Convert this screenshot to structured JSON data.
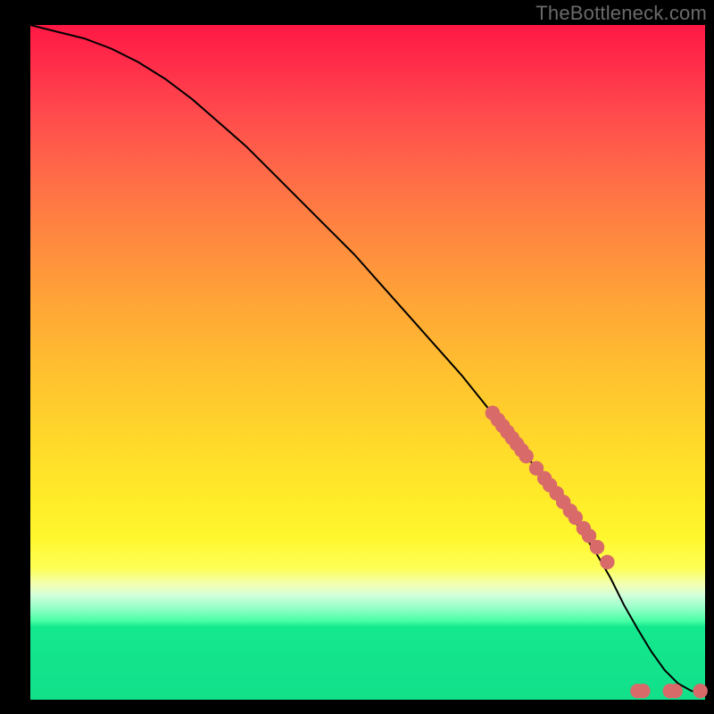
{
  "attribution": "TheBottleneck.com",
  "chart_data": {
    "type": "line",
    "title": "",
    "xlabel": "",
    "ylabel": "",
    "xlim": [
      0,
      100
    ],
    "ylim": [
      0,
      100
    ],
    "series": [
      {
        "name": "bottleneck-curve",
        "x": [
          0,
          4,
          8,
          12,
          16,
          20,
          24,
          28,
          32,
          36,
          40,
          44,
          48,
          52,
          56,
          60,
          64,
          68,
          72,
          76,
          80,
          84,
          86,
          88,
          90,
          92,
          94,
          96,
          98,
          100
        ],
        "y": [
          100,
          99,
          98,
          96.5,
          94.5,
          92,
          89,
          85.5,
          82,
          78,
          74,
          70,
          66,
          61.5,
          57,
          52.5,
          48,
          43,
          38,
          33,
          27.5,
          21.5,
          18,
          14,
          10.5,
          7.2,
          4.4,
          2.4,
          1.3,
          1.0
        ]
      }
    ],
    "scatter_points": {
      "name": "data-points",
      "x": [
        68.5,
        69.3,
        70.0,
        70.7,
        71.4,
        72.1,
        72.8,
        73.5,
        75.0,
        76.2,
        77.0,
        78.0,
        79.0,
        80.0,
        80.8,
        82.0,
        82.8,
        84.0,
        85.5,
        90.0,
        90.8,
        94.8,
        95.6,
        99.3
      ],
      "y": [
        42.5,
        41.5,
        40.6,
        39.7,
        38.8,
        37.9,
        37.0,
        36.1,
        34.3,
        32.8,
        31.8,
        30.6,
        29.3,
        28.0,
        27.0,
        25.4,
        24.3,
        22.6,
        20.4,
        1.3,
        1.3,
        1.3,
        1.3,
        1.3
      ]
    },
    "dot_color": "#d86a6a",
    "gradient": {
      "top": "#ff1844",
      "mid": "#ffd92a",
      "bottom": "#12e08a"
    }
  }
}
